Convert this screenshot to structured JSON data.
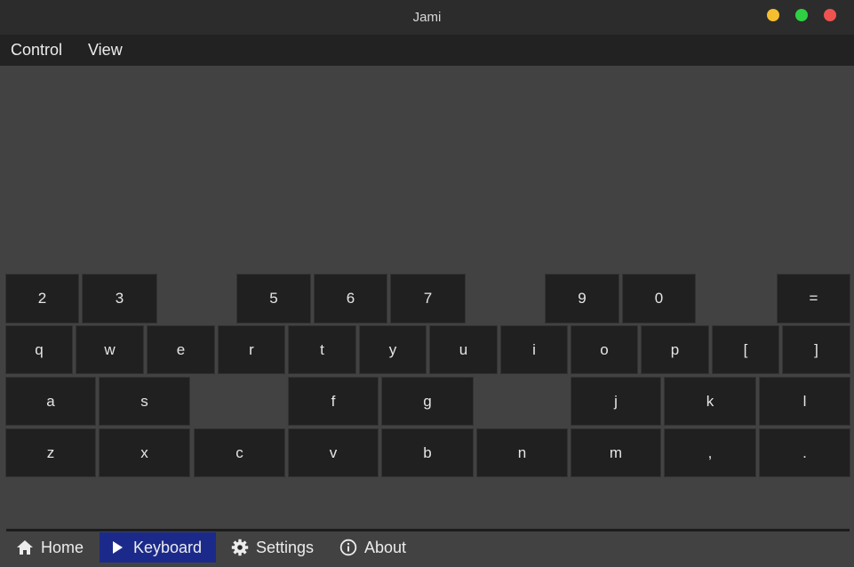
{
  "window": {
    "title": "Jami",
    "controls": [
      {
        "name": "minimize",
        "color": "#f5be2e"
      },
      {
        "name": "maximize",
        "color": "#2fcf43"
      },
      {
        "name": "close",
        "color": "#ef5350"
      }
    ]
  },
  "menu": [
    "Control",
    "View"
  ],
  "keyboard": {
    "rows": [
      [
        "2",
        "3",
        "",
        "5",
        "6",
        "7",
        "",
        "9",
        "0",
        "",
        "="
      ],
      [
        "q",
        "w",
        "e",
        "r",
        "t",
        "y",
        "u",
        "i",
        "o",
        "p",
        "[",
        "]"
      ],
      [
        "a",
        "s",
        "",
        "f",
        "g",
        "",
        "j",
        "k",
        "l"
      ],
      [
        "z",
        "x",
        "c",
        "v",
        "b",
        "n",
        "m",
        ",",
        "."
      ]
    ]
  },
  "nav": {
    "items": [
      {
        "label": "Home",
        "icon": "home-icon"
      },
      {
        "label": "Keyboard",
        "icon": "play-icon",
        "active": true
      },
      {
        "label": "Settings",
        "icon": "gear-icon"
      },
      {
        "label": "About",
        "icon": "info-icon"
      }
    ]
  },
  "colors": {
    "accent": "#1b2a8a",
    "key_bg": "#202020",
    "content_bg": "#424242"
  }
}
